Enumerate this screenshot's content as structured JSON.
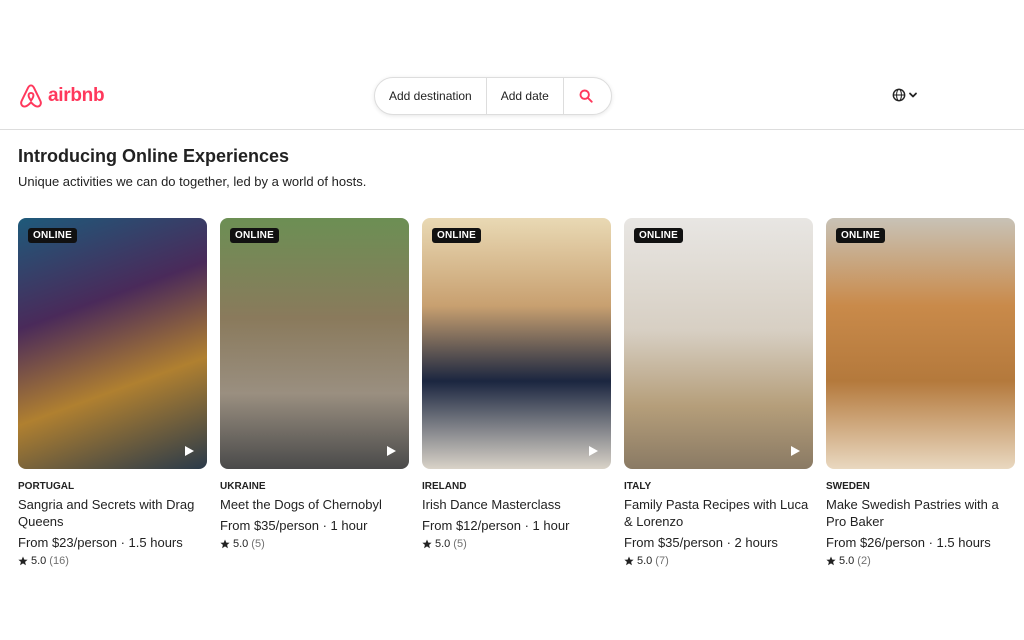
{
  "header": {
    "logo_text": "airbnb",
    "brand_color": "#ff385c",
    "search": {
      "destination_label": "Add destination",
      "date_label": "Add date",
      "search_icon": "search-icon"
    },
    "language_icon": "globe-icon"
  },
  "main": {
    "title": "Introducing Online Experiences",
    "subtitle": "Unique activities we can do together, led by a world of hosts."
  },
  "cards": [
    {
      "badge": "ONLINE",
      "country": "PORTUGAL",
      "title": "Sangria and Secrets with Drag Queens",
      "price": "From $23/person · 1.5 hours",
      "rating": "5.0",
      "count": "(16)",
      "has_play": true
    },
    {
      "badge": "ONLINE",
      "country": "UKRAINE",
      "title": "Meet the Dogs of Chernobyl",
      "price": "From $35/person · 1 hour",
      "rating": "5.0",
      "count": "(5)",
      "has_play": true
    },
    {
      "badge": "ONLINE",
      "country": "IRELAND",
      "title": "Irish Dance Masterclass",
      "price": "From $12/person · 1 hour",
      "rating": "5.0",
      "count": "(5)",
      "has_play": true
    },
    {
      "badge": "ONLINE",
      "country": "ITALY",
      "title": "Family Pasta Recipes with Luca & Lorenzo",
      "price": "From $35/person · 2 hours",
      "rating": "5.0",
      "count": "(7)",
      "has_play": true
    },
    {
      "badge": "ONLINE",
      "country": "SWEDEN",
      "title": "Make Swedish Pastries with a Pro Baker",
      "price": "From $26/person · 1.5 hours",
      "rating": "5.0",
      "count": "(2)",
      "has_play": false
    }
  ]
}
